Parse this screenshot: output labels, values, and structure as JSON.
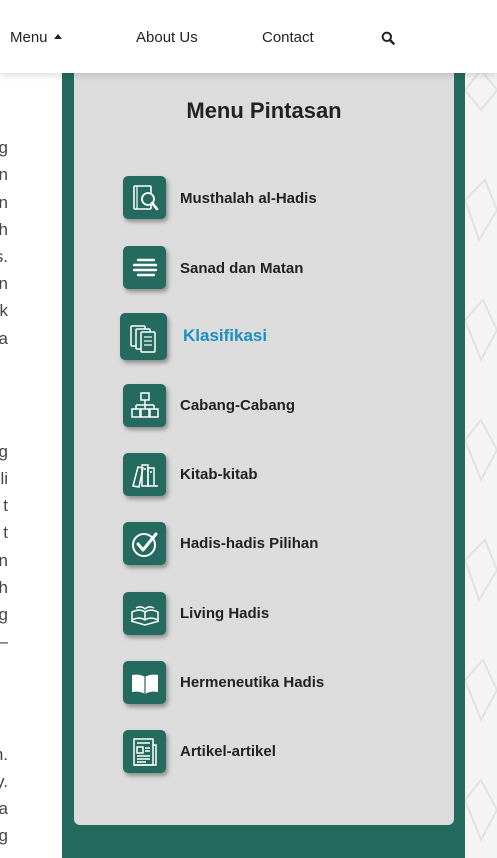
{
  "nav": {
    "menu_label": "Menu",
    "about_label": "About Us",
    "contact_label": "Contact",
    "search_icon": "search-icon"
  },
  "left_article_fragments": [
    "g",
    "n",
    "n",
    "h",
    "s.",
    "n",
    "k",
    "a",
    "g",
    "li",
    "t",
    "t",
    "n",
    "h",
    "g",
    "–",
    "n.",
    "y.",
    "a",
    "g"
  ],
  "panel": {
    "title": "Menu Pintasan",
    "items": [
      {
        "label": "Musthalah al-Hadis",
        "icon": "book-magnifier-icon"
      },
      {
        "label": "Sanad dan Matan",
        "icon": "lines-icon"
      },
      {
        "label": "Klasifikasi",
        "icon": "documents-icon",
        "active": true
      },
      {
        "label": "Cabang-Cabang",
        "icon": "hierarchy-icon"
      },
      {
        "label": "Kitab-kitab",
        "icon": "books-icon"
      },
      {
        "label": "Hadis-hadis Pilihan",
        "icon": "checkmark-icon"
      },
      {
        "label": "Living Hadis",
        "icon": "book-stack-icon"
      },
      {
        "label": "Hermeneutika Hadis",
        "icon": "open-book-icon"
      },
      {
        "label": "Artikel-artikel",
        "icon": "newspaper-icon"
      }
    ]
  },
  "colors": {
    "brand_green": "#246a5e",
    "panel_bg": "#dcdcdc",
    "active_link": "#1a8fc2"
  }
}
